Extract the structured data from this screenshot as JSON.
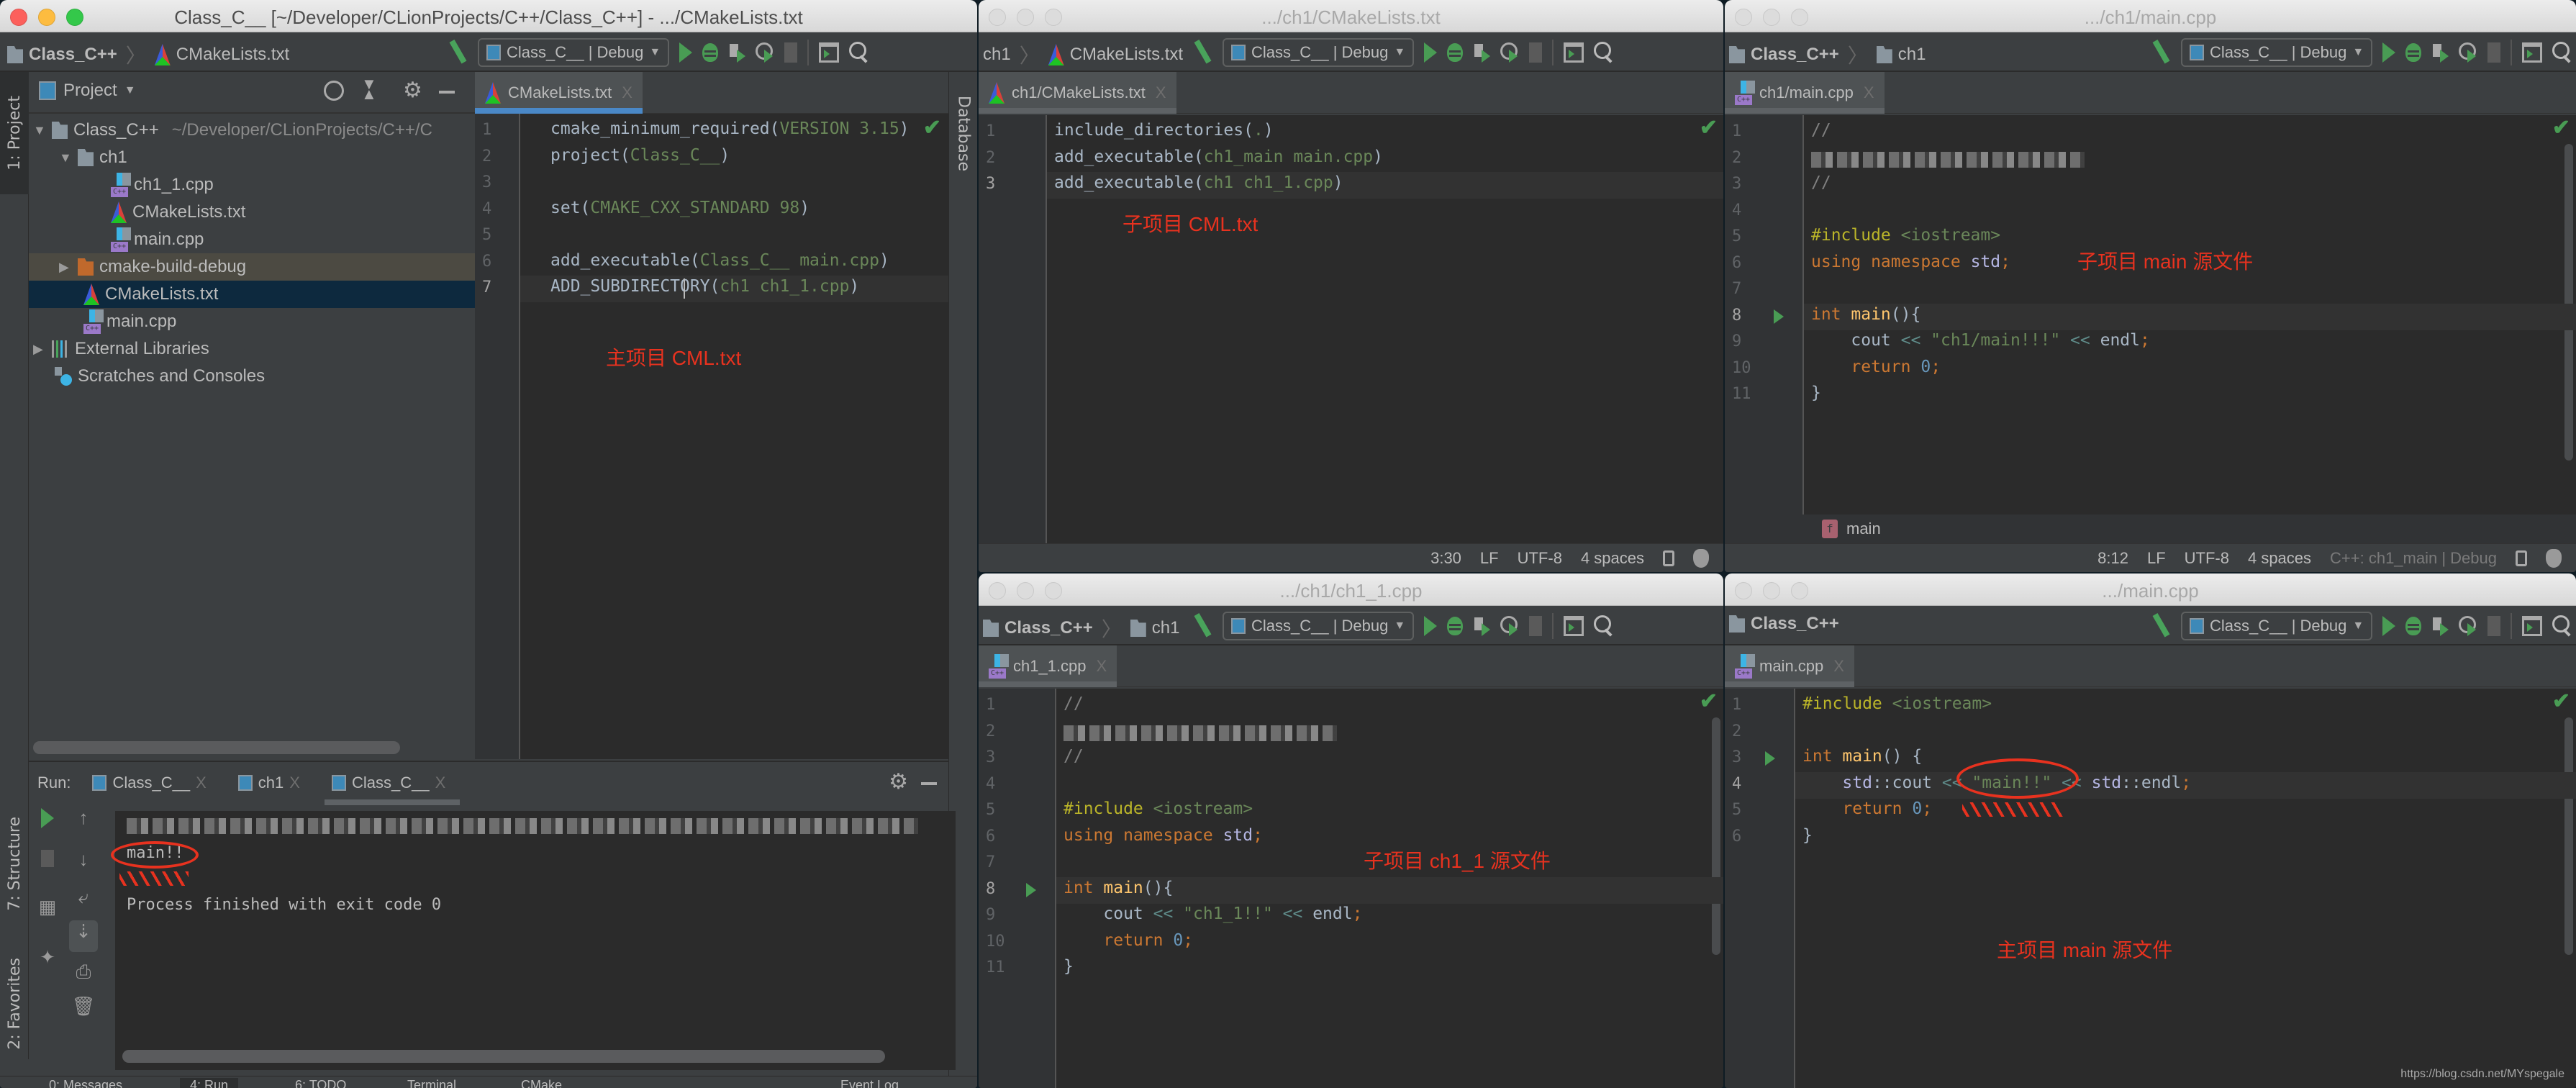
{
  "main_window": {
    "title": "Class_C__ [~/Developer/CLionProjects/C++/Class_C++] - .../CMakeLists.txt",
    "breadcrumb": [
      "Class_C++",
      "CMakeLists.txt"
    ],
    "run_config": "Class_C__ | Debug",
    "left_stripe": [
      "1: Project",
      "7: Structure",
      "2: Favorites"
    ],
    "right_stripe": [
      "Database"
    ],
    "project_panel": {
      "title": "Project",
      "tree": [
        {
          "label": "Class_C++",
          "path": "~/Developer/CLionProjects/C++/C",
          "type": "folder",
          "expanded": true
        },
        {
          "label": "ch1",
          "type": "folder",
          "expanded": true
        },
        {
          "label": "ch1_1.cpp",
          "type": "cpp"
        },
        {
          "label": "CMakeLists.txt",
          "type": "cmake"
        },
        {
          "label": "main.cpp",
          "type": "cpp"
        },
        {
          "label": "cmake-build-debug",
          "type": "excluded-folder",
          "expanded": false
        },
        {
          "label": "CMakeLists.txt",
          "type": "cmake",
          "selected": true
        },
        {
          "label": "main.cpp",
          "type": "cpp"
        },
        {
          "label": "External Libraries",
          "type": "library",
          "expanded": false
        },
        {
          "label": "Scratches and Consoles",
          "type": "scratch"
        }
      ]
    },
    "editor": {
      "tab": "CMakeLists.txt",
      "lines": [
        {
          "n": "1",
          "parts": [
            [
              "",
              "cmake_minimum_required("
            ],
            [
              "s",
              "VERSION 3.15"
            ],
            [
              "",
              ")"
            ]
          ]
        },
        {
          "n": "2",
          "parts": [
            [
              "",
              "project("
            ],
            [
              "s",
              "Class_C__"
            ],
            [
              "",
              ")"
            ]
          ]
        },
        {
          "n": "3",
          "parts": []
        },
        {
          "n": "4",
          "parts": [
            [
              "",
              "set("
            ],
            [
              "s",
              "CMAKE_CXX_STANDARD 98"
            ],
            [
              "",
              ")"
            ]
          ]
        },
        {
          "n": "5",
          "parts": []
        },
        {
          "n": "6",
          "parts": [
            [
              "",
              "add_executable("
            ],
            [
              "s",
              "Class_C__ main.cpp"
            ],
            [
              "",
              ")"
            ]
          ]
        },
        {
          "n": "7",
          "parts": [
            [
              "",
              "ADD_SUBDIRECTORY("
            ],
            [
              "s",
              "ch1 ch1_1.cpp"
            ],
            [
              "",
              ")"
            ]
          ]
        }
      ],
      "current_line": "7",
      "annotation": "主项目 CML.txt"
    },
    "run_panel": {
      "label": "Run:",
      "tabs": [
        "Class_C__",
        "ch1",
        "Class_C__"
      ],
      "active_tab": 2,
      "output": [
        "main!!",
        "",
        "Process finished with exit code 0"
      ],
      "blurred_first_line": true
    },
    "bottom_tool_tabs": [
      "0: Messages",
      "4: Run",
      "6: TODO",
      "Terminal",
      "CMake",
      "Event Log"
    ]
  },
  "windows": [
    {
      "id": "ch1-cmakelists",
      "title": ".../ch1/CMakeLists.txt",
      "breadcrumb": [
        "ch1",
        "CMakeLists.txt"
      ],
      "run_config": "Class_C__ | Debug",
      "tab": "ch1/CMakeLists.txt",
      "lines": [
        {
          "n": "1",
          "parts": [
            [
              "",
              "include_directories("
            ],
            [
              "s",
              "."
            ],
            [
              "",
              ")"
            ]
          ]
        },
        {
          "n": "2",
          "parts": [
            [
              "",
              "add_executable("
            ],
            [
              "s",
              "ch1_main main.cpp"
            ],
            [
              "",
              ")"
            ]
          ]
        },
        {
          "n": "3",
          "parts": [
            [
              "",
              "add_executable("
            ],
            [
              "s",
              "ch1 ch1_1.cpp"
            ],
            [
              "",
              ")"
            ]
          ]
        }
      ],
      "current_line": "3",
      "annotation": "子项目 CML.txt",
      "status": {
        "position": "3:30",
        "line_sep": "LF",
        "encoding": "UTF-8",
        "indent": "4 spaces"
      }
    },
    {
      "id": "ch1-main",
      "title": ".../ch1/main.cpp",
      "breadcrumb": [
        "Class_C++",
        "ch1"
      ],
      "run_config": "Class_C__ | Debug",
      "tab": "ch1/main.cpp",
      "lines": [
        {
          "n": "1",
          "parts": [
            [
              "cm",
              "//"
            ]
          ]
        },
        {
          "n": "2",
          "parts": [],
          "blurred": true
        },
        {
          "n": "3",
          "parts": [
            [
              "cm",
              "//"
            ]
          ]
        },
        {
          "n": "4",
          "parts": []
        },
        {
          "n": "5",
          "parts": [
            [
              "pp",
              "#include "
            ],
            [
              "s",
              "<iostream>"
            ]
          ]
        },
        {
          "n": "6",
          "parts": [
            [
              "k",
              "using namespace "
            ],
            [
              "ns",
              "std"
            ],
            [
              "k",
              ";"
            ]
          ]
        },
        {
          "n": "7",
          "parts": []
        },
        {
          "n": "8",
          "parts": [
            [
              "k",
              "int "
            ],
            [
              "fn",
              "main"
            ],
            [
              "",
              "(){"
            ]
          ],
          "runnable": true
        },
        {
          "n": "9",
          "parts": [
            [
              "",
              "    cout "
            ],
            [
              "op",
              "<<"
            ],
            [
              "s",
              " \"ch1/main!!!\" "
            ],
            [
              "op",
              "<<"
            ],
            [
              "",
              " endl"
            ],
            [
              "k",
              ";"
            ]
          ]
        },
        {
          "n": "10",
          "parts": [
            [
              "k",
              "    return "
            ],
            [
              "num",
              "0"
            ],
            [
              "k",
              ";"
            ]
          ]
        },
        {
          "n": "11",
          "parts": [
            [
              "",
              "}"
            ]
          ]
        }
      ],
      "current_line": "8",
      "annotation": "子项目 main 源文件",
      "nav_function": "main",
      "status": {
        "position": "8:12",
        "line_sep": "LF",
        "encoding": "UTF-8",
        "indent": "4 spaces",
        "context": "C++: ch1_main | Debug"
      }
    },
    {
      "id": "ch1-1-cpp",
      "title": ".../ch1/ch1_1.cpp",
      "breadcrumb": [
        "Class_C++",
        "ch1"
      ],
      "run_config": "Class_C__ | Debug",
      "tab": "ch1_1.cpp",
      "lines": [
        {
          "n": "1",
          "parts": [
            [
              "cm",
              "//"
            ]
          ]
        },
        {
          "n": "2",
          "parts": [],
          "blurred": true
        },
        {
          "n": "3",
          "parts": [
            [
              "cm",
              "//"
            ]
          ]
        },
        {
          "n": "4",
          "parts": []
        },
        {
          "n": "5",
          "parts": [
            [
              "pp",
              "#include "
            ],
            [
              "s",
              "<iostream>"
            ]
          ]
        },
        {
          "n": "6",
          "parts": [
            [
              "k",
              "using namespace "
            ],
            [
              "ns",
              "std"
            ],
            [
              "k",
              ";"
            ]
          ]
        },
        {
          "n": "7",
          "parts": []
        },
        {
          "n": "8",
          "parts": [
            [
              "k",
              "int "
            ],
            [
              "fn",
              "main"
            ],
            [
              "",
              "(){"
            ]
          ],
          "runnable": true
        },
        {
          "n": "9",
          "parts": [
            [
              "",
              "    cout "
            ],
            [
              "op",
              "<<"
            ],
            [
              "s",
              " \"ch1_1!!\" "
            ],
            [
              "op",
              "<<"
            ],
            [
              "",
              " endl"
            ],
            [
              "k",
              ";"
            ]
          ]
        },
        {
          "n": "10",
          "parts": [
            [
              "k",
              "    return "
            ],
            [
              "num",
              "0"
            ],
            [
              "k",
              ";"
            ]
          ]
        },
        {
          "n": "11",
          "parts": [
            [
              "",
              "}"
            ]
          ]
        }
      ],
      "current_line": "8",
      "annotation": "子项目 ch1_1 源文件"
    },
    {
      "id": "main-cpp",
      "title": ".../main.cpp",
      "breadcrumb": [
        "Class_C++"
      ],
      "run_config": "Class_C__ | Debug",
      "tab": "main.cpp",
      "lines": [
        {
          "n": "1",
          "parts": [
            [
              "pp",
              "#include "
            ],
            [
              "s",
              "<iostream>"
            ]
          ]
        },
        {
          "n": "2",
          "parts": []
        },
        {
          "n": "3",
          "parts": [
            [
              "k",
              "int "
            ],
            [
              "fn",
              "main"
            ],
            [
              "",
              "() {"
            ]
          ],
          "runnable": true
        },
        {
          "n": "4",
          "parts": [
            [
              "ns",
              "    std"
            ],
            [
              "",
              "::cout "
            ],
            [
              "op",
              "<<"
            ],
            [
              "s",
              " \"main!!\" "
            ],
            [
              "op",
              "<<"
            ],
            [
              "ns",
              " std"
            ],
            [
              "",
              "::endl"
            ],
            [
              "k",
              ";"
            ]
          ]
        },
        {
          "n": "5",
          "parts": [
            [
              "k",
              "    return "
            ],
            [
              "num",
              "0"
            ],
            [
              "k",
              ";"
            ]
          ]
        },
        {
          "n": "6",
          "parts": [
            [
              "",
              "}"
            ]
          ]
        }
      ],
      "current_line": "4",
      "annotation": "主项目 main 源文件",
      "watermark": "https://blog.csdn.net/MYspegale"
    }
  ],
  "colors": {
    "accent_tab": "#4a88c7",
    "run_green": "#499c54",
    "annotation_red": "#e8321f",
    "selection": "#0d293e",
    "editor_bg": "#2b2b2b"
  }
}
